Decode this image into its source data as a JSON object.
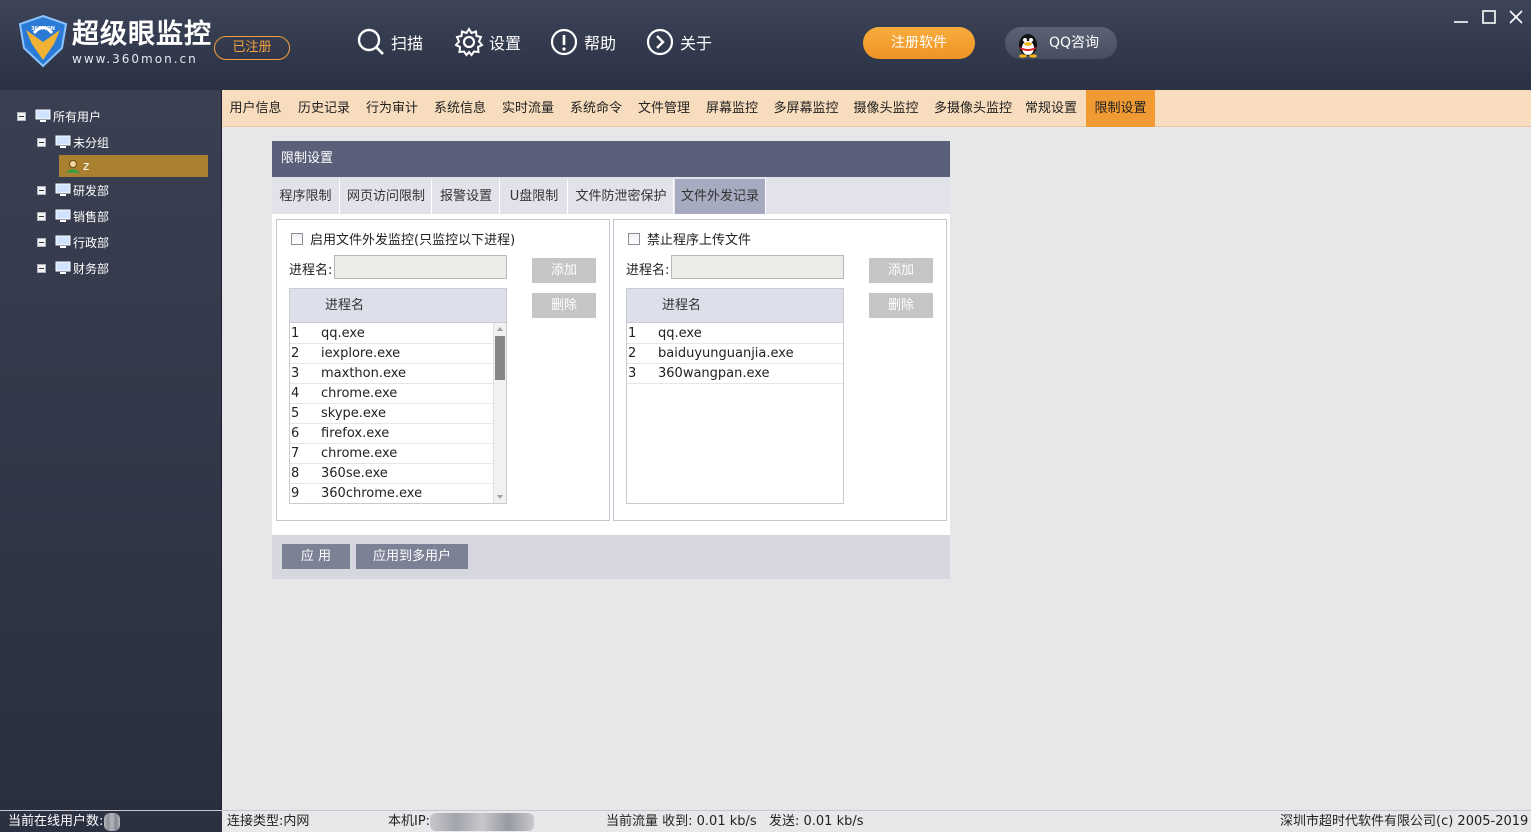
{
  "app": {
    "brand_name": "超级眼监控",
    "brand_url": "www.360mon.cn",
    "registered_badge": "已注册",
    "logo_text": "360MON"
  },
  "header_nav": [
    {
      "label": "扫描",
      "icon": "search-icon"
    },
    {
      "label": "设置",
      "icon": "gear-icon"
    },
    {
      "label": "帮助",
      "icon": "exclamation-circle-icon"
    },
    {
      "label": "关于",
      "icon": "chevron-right-circle-icon"
    }
  ],
  "header_actions": {
    "register_label": "注册软件",
    "qq_label": "QQ咨询"
  },
  "sidebar": {
    "root": "所有用户",
    "groups": [
      {
        "label": "未分组",
        "users": [
          "z"
        ]
      },
      {
        "label": "研发部"
      },
      {
        "label": "销售部"
      },
      {
        "label": "行政部"
      },
      {
        "label": "财务部"
      }
    ]
  },
  "tabs": [
    "用户信息",
    "历史记录",
    "行为审计",
    "系统信息",
    "实时流量",
    "系统命令",
    "文件管理",
    "屏幕监控",
    "多屏幕监控",
    "摄像头监控",
    "多摄像头监控",
    "常规设置",
    "限制设置"
  ],
  "active_tab": "限制设置",
  "panel": {
    "title": "限制设置",
    "subtabs": [
      "程序限制",
      "网页访问限制",
      "报警设置",
      "U盘限制",
      "文件防泄密保护",
      "文件外发记录"
    ],
    "active_subtab": "文件外发记录",
    "left": {
      "checkbox_label": "启用文件外发监控(只监控以下进程)",
      "checked": false,
      "process_label": "进程名:",
      "process_value": "",
      "add_label": "添加",
      "delete_label": "删除",
      "column_header": "进程名",
      "rows": [
        {
          "idx": "1",
          "name": "qq.exe"
        },
        {
          "idx": "2",
          "name": "iexplore.exe"
        },
        {
          "idx": "3",
          "name": "maxthon.exe"
        },
        {
          "idx": "4",
          "name": "chrome.exe"
        },
        {
          "idx": "5",
          "name": "skype.exe"
        },
        {
          "idx": "6",
          "name": "firefox.exe"
        },
        {
          "idx": "7",
          "name": "chrome.exe"
        },
        {
          "idx": "8",
          "name": "360se.exe"
        },
        {
          "idx": "9",
          "name": "360chrome.exe"
        }
      ]
    },
    "right": {
      "checkbox_label": "禁止程序上传文件",
      "checked": false,
      "process_label": "进程名:",
      "process_value": "",
      "add_label": "添加",
      "delete_label": "删除",
      "column_header": "进程名",
      "rows": [
        {
          "idx": "1",
          "name": "qq.exe"
        },
        {
          "idx": "2",
          "name": "baiduyunguanjia.exe"
        },
        {
          "idx": "3",
          "name": "360wangpan.exe"
        }
      ]
    },
    "apply_label": "应 用",
    "apply_multi_label": "应用到多用户"
  },
  "statusbar": {
    "online_users_label": "当前在线用户数:",
    "connection_type": "连接类型:内网",
    "local_ip_label": "本机IP:",
    "traffic_recv": "当前流量 收到: 0.01 kb/s",
    "traffic_send": "发送: 0.01 kb/s",
    "copyright": "深圳市超时代软件有限公司(c) 2005-2019"
  },
  "colors": {
    "accent_orange": "#f09a34",
    "header_bg": "#353b4e",
    "panel_title_bg": "#5a6079",
    "tabbar_bg": "#f7dcbd"
  }
}
